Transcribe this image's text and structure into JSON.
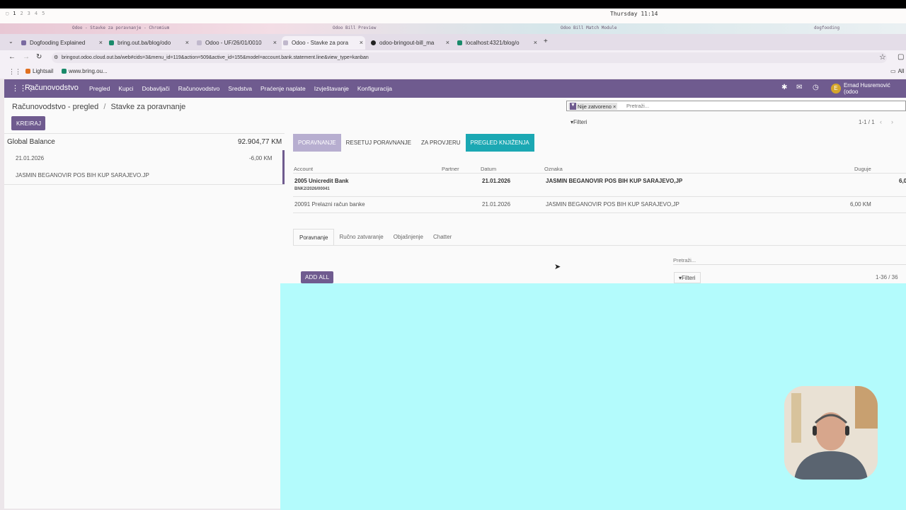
{
  "system_bar": {
    "workspaces": [
      "1",
      "2",
      "3",
      "4",
      "5"
    ],
    "clock": "Thursday 11:14"
  },
  "window_titles": {
    "left": "Odoo - Stavke za poravnanje - Chromium",
    "middle": "Odoo Bill Preview",
    "right1": "Odoo Bill Match Module",
    "right2": "dogfooding"
  },
  "browser": {
    "tabs": [
      {
        "label": "Dogfooding Explained",
        "active": false
      },
      {
        "label": "bring.out.ba/blog/odo",
        "active": false
      },
      {
        "label": "Odoo - UF/26/01/0010",
        "active": false
      },
      {
        "label": "Odoo - Stavke za pora",
        "active": true
      },
      {
        "label": "odoo-bringout-bill_ma",
        "active": false
      },
      {
        "label": "localhost:4321/blog/o",
        "active": false
      }
    ],
    "new_tab": "+",
    "url": "bringout.odoo.cloud.out.ba/web#cids=3&menu_id=119&action=509&active_id=155&model=account.bank.statement.line&view_type=kanban",
    "bookmarks": [
      "Lightsail",
      "www.bring.ou..."
    ],
    "all_bookmarks": "All"
  },
  "odoo_nav": {
    "brand": "Računovodstvo",
    "menu": [
      "Pregled",
      "Kupci",
      "Dobavljači",
      "Računovodstvo",
      "Sredstva",
      "Praćenje naplate",
      "Izvještavanje",
      "Konfiguracija"
    ],
    "user_initial": "E",
    "user": "Ernad Husremović (odoo"
  },
  "breadcrumb": {
    "parent": "Računovodstvo - pregled",
    "sep": "/",
    "current": "Stavke za poravnanje"
  },
  "create_button": "KREIRAJ",
  "search": {
    "facet": "Nije zatvoreno",
    "placeholder": "Pretraži...",
    "filters": "Filteri",
    "pager": "1-1 / 1"
  },
  "left_panel": {
    "global_label": "Global Balance",
    "global_amount": "92.904,77 KM",
    "line": {
      "date": "21.01.2026",
      "amount": "-6,00 KM",
      "label": "JASMIN BEGANOVIR POS BIH KUP SARAJEVO.JP"
    }
  },
  "actions": [
    "PORAVNANJE",
    "RESETUJ PORAVNANJE",
    "ZA PROVJERU",
    "PREGLED KNJIŽENJA"
  ],
  "table": {
    "headers": [
      "Account",
      "Partner",
      "Datum",
      "Oznaka",
      "Duguje"
    ],
    "rows": [
      {
        "account": "2005 Unicredit Bank",
        "sub": "BNK2/2026/00041",
        "partner": "",
        "date": "21.01.2026",
        "label": "JASMIN BEGANOVIR POS BIH KUP SARAJEVO,JP",
        "debit": "6,0"
      },
      {
        "account": "20091 Prelazni račun banke",
        "sub": "",
        "partner": "",
        "date": "21.01.2026",
        "label": "JASMIN BEGANOVIR POS BIH KUP SARAJEVO,JP",
        "debit": "6,00 KM"
      }
    ]
  },
  "subtabs": [
    "Poravnanje",
    "Ručno zatvaranje",
    "Objašnjenje",
    "Chatter"
  ],
  "bottom": {
    "search_placeholder": "Pretraži...",
    "add_all": "ADD ALL",
    "filters": "Filteri",
    "pager": "1-36 / 36"
  },
  "colors": {
    "odoo_purple": "#6f5b8f",
    "teal": "#1ba8b3",
    "overlay_cyan": "#b3fbfc"
  }
}
